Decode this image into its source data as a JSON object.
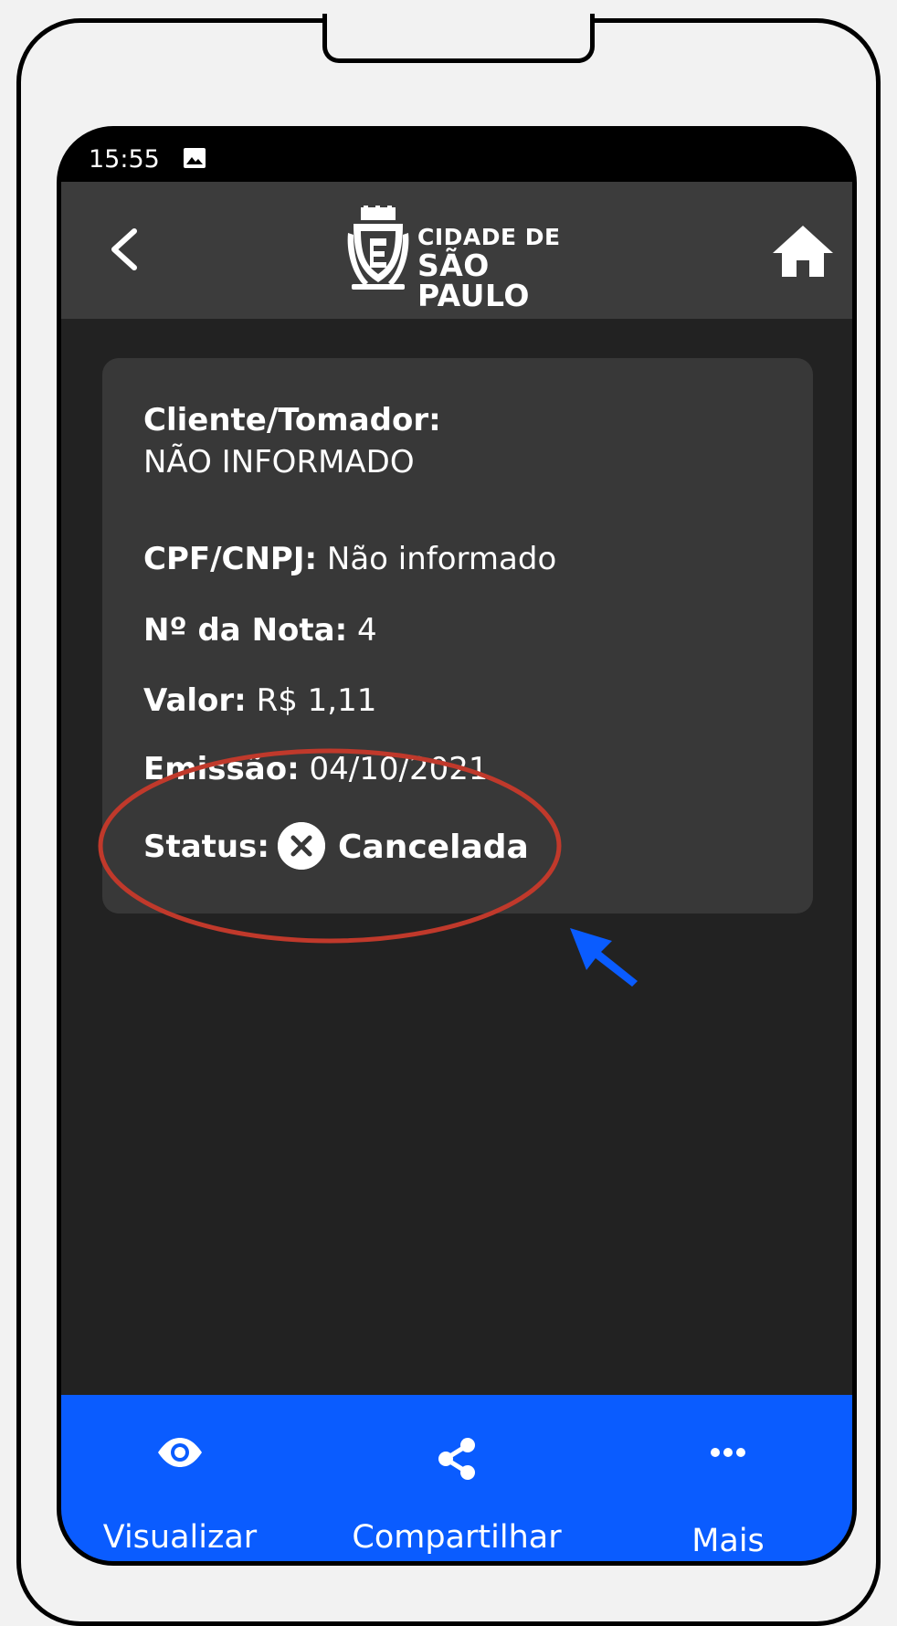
{
  "status_bar": {
    "time": "15:55",
    "image_icon": "image-icon"
  },
  "app_bar": {
    "back_icon": "chevron-left-icon",
    "logo_line1": "CIDADE DE",
    "logo_line2": "SÃO PAULO",
    "home_icon": "home-icon"
  },
  "invoice": {
    "client_label": "Cliente/Tomador:",
    "client_value": "NÃO INFORMADO",
    "rows": [
      {
        "key": "CPF/CNPJ:",
        "value": "Não informado"
      },
      {
        "key": "Nº da Nota:",
        "value": "4"
      },
      {
        "key": "Valor:",
        "value": "R$ 1,11"
      },
      {
        "key": "Emissão:",
        "value": "04/10/2021"
      }
    ],
    "status_label": "Status:",
    "status_value": "Cancelada",
    "status_icon": "close-circle-icon"
  },
  "bottom_nav": [
    {
      "label": "Visualizar",
      "icon": "eye-icon"
    },
    {
      "label": "Compartilhar",
      "icon": "share-icon"
    },
    {
      "label": "Mais",
      "icon": "more-horizontal-icon"
    }
  ],
  "colors": {
    "accent": "#0a5cff",
    "annotation_ellipse": "#c0392b",
    "annotation_arrow": "#0a5cff",
    "appbar": "#3c3c3c",
    "card": "#383838",
    "background": "#222222"
  }
}
